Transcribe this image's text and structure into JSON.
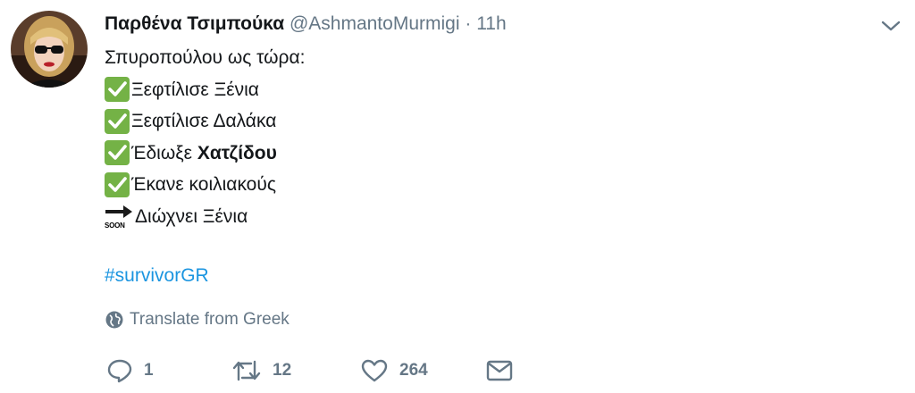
{
  "tweet": {
    "author_name": "Παρθένα Τσιμπούκα",
    "author_handle": "@AshmantoMurmigi",
    "separator": "·",
    "time": "11h",
    "lines": [
      {
        "icon": "check-mark-button-emoji",
        "text": "Σπυροπούλου ως τώρα:"
      },
      {
        "icon": "check-mark-button-emoji",
        "text": "Ξεφτίλισε Ξένια"
      },
      {
        "icon": "check-mark-button-emoji",
        "text": "Ξεφτίλισε Δαλάκα"
      },
      {
        "icon": "check-mark-button-emoji",
        "text_before": "Έδιωξε ",
        "text_bold": "Χατζίδου"
      },
      {
        "icon": "check-mark-button-emoji",
        "text": "Έκανε κοιλιακούς"
      },
      {
        "icon": "soon-arrow-emoji",
        "icon_text": "SOON",
        "text": "Διώχνει Ξένια"
      }
    ],
    "hashtag": "#survivorGR",
    "translate_label": "Translate from Greek"
  },
  "actions": {
    "reply_count": "1",
    "retweet_count": "12",
    "like_count": "264"
  },
  "colors": {
    "link": "#1b95e0",
    "secondary": "#657786",
    "check_green": "#74b246"
  }
}
